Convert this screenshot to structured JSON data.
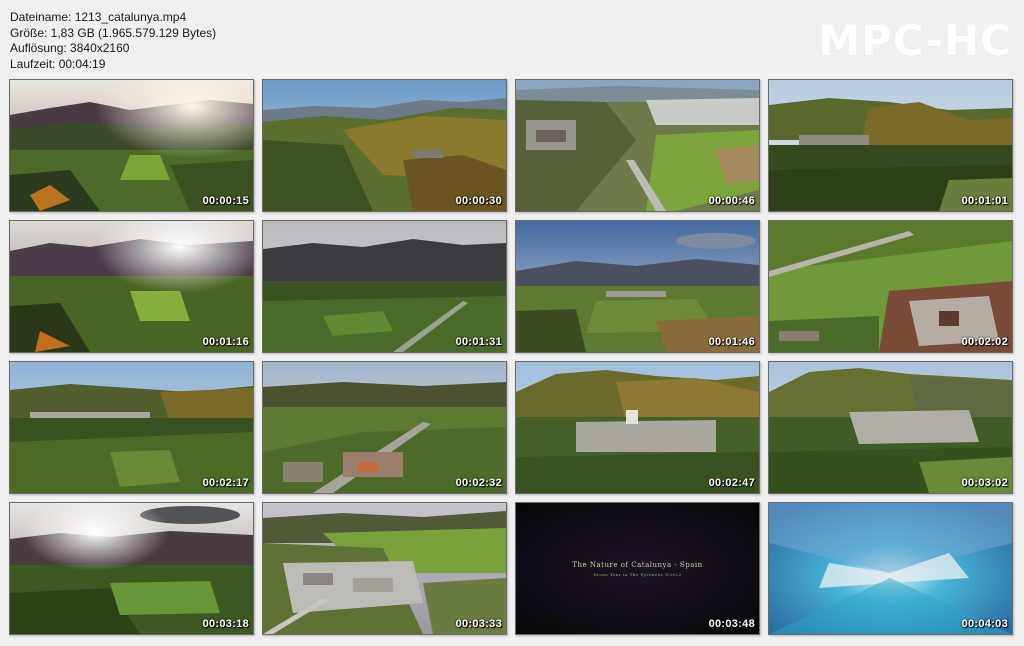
{
  "header": {
    "filename": "Dateiname: 1213_catalunya.mp4",
    "size": "Größe: 1,83 GB (1.965.579.129 Bytes)",
    "resolution": "Auflösung: 3840x2160",
    "duration": "Laufzeit: 00:04:19"
  },
  "logo": "MPC-HC",
  "title_card": {
    "line1": "The Nature of Catalunya - Spain",
    "line2": "Drone Tour in The Pyrenees ©2022"
  },
  "thumbnails": [
    {
      "time": "00:00:15",
      "scene": "valley-sunset"
    },
    {
      "time": "00:00:30",
      "scene": "forest-hills"
    },
    {
      "time": "00:00:46",
      "scene": "village-fields"
    },
    {
      "time": "00:01:01",
      "scene": "forest-village"
    },
    {
      "time": "00:01:16",
      "scene": "valley-sunset"
    },
    {
      "time": "00:01:31",
      "scene": "dark-valley"
    },
    {
      "time": "00:01:46",
      "scene": "open-valley"
    },
    {
      "time": "00:02:02",
      "scene": "rooftops"
    },
    {
      "time": "00:02:17",
      "scene": "forest-village"
    },
    {
      "time": "00:02:32",
      "scene": "town-road"
    },
    {
      "time": "00:02:47",
      "scene": "mountain-town"
    },
    {
      "time": "00:03:02",
      "scene": "mountain-town"
    },
    {
      "time": "00:03:18",
      "scene": "valley-sunset"
    },
    {
      "time": "00:03:33",
      "scene": "town-aerial"
    },
    {
      "time": "00:03:48",
      "scene": "title-card"
    },
    {
      "time": "00:04:03",
      "scene": "blue-zoom"
    }
  ],
  "colors": {
    "background": "#f0f0f0",
    "logo": "#ffffff",
    "timestamp": "#ffffff"
  }
}
